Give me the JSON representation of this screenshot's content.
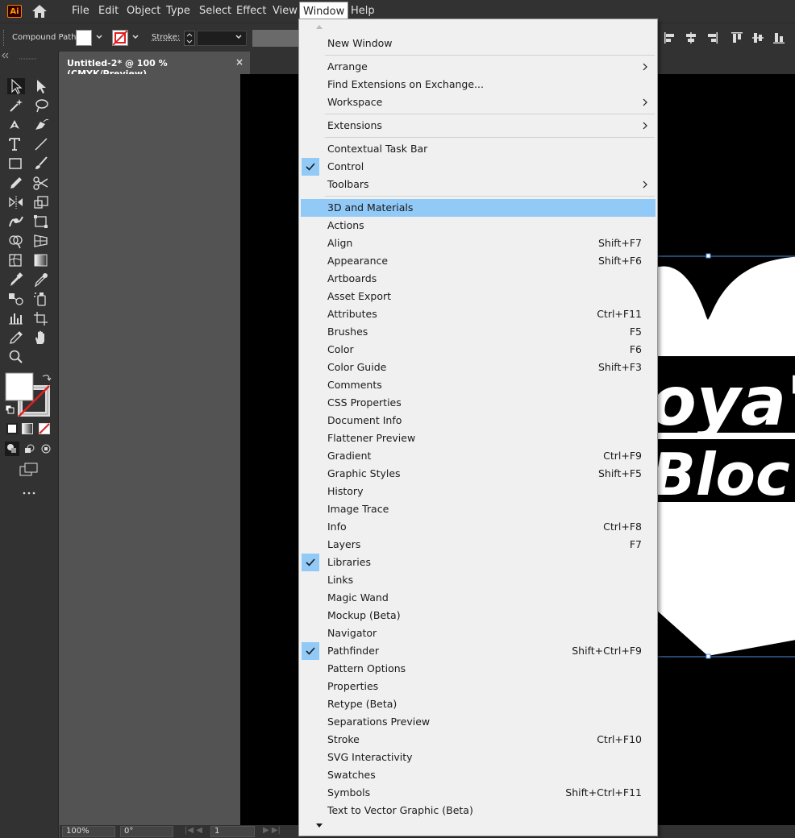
{
  "app": {
    "logo": "Ai",
    "menus": [
      "File",
      "Edit",
      "Object",
      "Type",
      "Select",
      "Effect",
      "View",
      "Window",
      "Help"
    ],
    "active_menu": "Window"
  },
  "control_bar": {
    "selection_type": "Compound Path",
    "stroke_label": "Stroke:"
  },
  "document": {
    "tab_title": "Untitled-2* @ 100 % (CMYK/Preview)",
    "close_glyph": "×"
  },
  "status_bar": {
    "zoom": "100%",
    "rotation": "0°",
    "artboard_number": "1"
  },
  "artwork": {
    "visible_text": [
      "oya'",
      "Bloc"
    ]
  },
  "window_menu": {
    "items": [
      {
        "label": "New Window",
        "shortcut": "",
        "submenu": false,
        "checked": false,
        "highlighted": false
      },
      {
        "separator": true
      },
      {
        "label": "Arrange",
        "shortcut": "",
        "submenu": true,
        "checked": false,
        "highlighted": false
      },
      {
        "label": "Find Extensions on Exchange...",
        "shortcut": "",
        "submenu": false,
        "checked": false,
        "highlighted": false
      },
      {
        "label": "Workspace",
        "shortcut": "",
        "submenu": true,
        "checked": false,
        "highlighted": false
      },
      {
        "separator": true
      },
      {
        "label": "Extensions",
        "shortcut": "",
        "submenu": true,
        "checked": false,
        "highlighted": false
      },
      {
        "separator": true
      },
      {
        "label": "Contextual Task Bar",
        "shortcut": "",
        "submenu": false,
        "checked": false,
        "highlighted": false
      },
      {
        "label": "Control",
        "shortcut": "",
        "submenu": false,
        "checked": true,
        "highlighted": false
      },
      {
        "label": "Toolbars",
        "shortcut": "",
        "submenu": true,
        "checked": false,
        "highlighted": false
      },
      {
        "separator": true
      },
      {
        "label": "3D and Materials",
        "shortcut": "",
        "submenu": false,
        "checked": false,
        "highlighted": true
      },
      {
        "label": "Actions",
        "shortcut": "",
        "submenu": false,
        "checked": false,
        "highlighted": false
      },
      {
        "label": "Align",
        "shortcut": "Shift+F7",
        "submenu": false,
        "checked": false,
        "highlighted": false
      },
      {
        "label": "Appearance",
        "shortcut": "Shift+F6",
        "submenu": false,
        "checked": false,
        "highlighted": false
      },
      {
        "label": "Artboards",
        "shortcut": "",
        "submenu": false,
        "checked": false,
        "highlighted": false
      },
      {
        "label": "Asset Export",
        "shortcut": "",
        "submenu": false,
        "checked": false,
        "highlighted": false
      },
      {
        "label": "Attributes",
        "shortcut": "Ctrl+F11",
        "submenu": false,
        "checked": false,
        "highlighted": false
      },
      {
        "label": "Brushes",
        "shortcut": "F5",
        "submenu": false,
        "checked": false,
        "highlighted": false
      },
      {
        "label": "Color",
        "shortcut": "F6",
        "submenu": false,
        "checked": false,
        "highlighted": false
      },
      {
        "label": "Color Guide",
        "shortcut": "Shift+F3",
        "submenu": false,
        "checked": false,
        "highlighted": false
      },
      {
        "label": "Comments",
        "shortcut": "",
        "submenu": false,
        "checked": false,
        "highlighted": false
      },
      {
        "label": "CSS Properties",
        "shortcut": "",
        "submenu": false,
        "checked": false,
        "highlighted": false
      },
      {
        "label": "Document Info",
        "shortcut": "",
        "submenu": false,
        "checked": false,
        "highlighted": false
      },
      {
        "label": "Flattener Preview",
        "shortcut": "",
        "submenu": false,
        "checked": false,
        "highlighted": false
      },
      {
        "label": "Gradient",
        "shortcut": "Ctrl+F9",
        "submenu": false,
        "checked": false,
        "highlighted": false
      },
      {
        "label": "Graphic Styles",
        "shortcut": "Shift+F5",
        "submenu": false,
        "checked": false,
        "highlighted": false
      },
      {
        "label": "History",
        "shortcut": "",
        "submenu": false,
        "checked": false,
        "highlighted": false
      },
      {
        "label": "Image Trace",
        "shortcut": "",
        "submenu": false,
        "checked": false,
        "highlighted": false
      },
      {
        "label": "Info",
        "shortcut": "Ctrl+F8",
        "submenu": false,
        "checked": false,
        "highlighted": false
      },
      {
        "label": "Layers",
        "shortcut": "F7",
        "submenu": false,
        "checked": false,
        "highlighted": false
      },
      {
        "label": "Libraries",
        "shortcut": "",
        "submenu": false,
        "checked": true,
        "highlighted": false
      },
      {
        "label": "Links",
        "shortcut": "",
        "submenu": false,
        "checked": false,
        "highlighted": false
      },
      {
        "label": "Magic Wand",
        "shortcut": "",
        "submenu": false,
        "checked": false,
        "highlighted": false
      },
      {
        "label": "Mockup (Beta)",
        "shortcut": "",
        "submenu": false,
        "checked": false,
        "highlighted": false
      },
      {
        "label": "Navigator",
        "shortcut": "",
        "submenu": false,
        "checked": false,
        "highlighted": false
      },
      {
        "label": "Pathfinder",
        "shortcut": "Shift+Ctrl+F9",
        "submenu": false,
        "checked": true,
        "highlighted": false
      },
      {
        "label": "Pattern Options",
        "shortcut": "",
        "submenu": false,
        "checked": false,
        "highlighted": false
      },
      {
        "label": "Properties",
        "shortcut": "",
        "submenu": false,
        "checked": false,
        "highlighted": false
      },
      {
        "label": "Retype (Beta)",
        "shortcut": "",
        "submenu": false,
        "checked": false,
        "highlighted": false
      },
      {
        "label": "Separations Preview",
        "shortcut": "",
        "submenu": false,
        "checked": false,
        "highlighted": false
      },
      {
        "label": "Stroke",
        "shortcut": "Ctrl+F10",
        "submenu": false,
        "checked": false,
        "highlighted": false
      },
      {
        "label": "SVG Interactivity",
        "shortcut": "",
        "submenu": false,
        "checked": false,
        "highlighted": false
      },
      {
        "label": "Swatches",
        "shortcut": "",
        "submenu": false,
        "checked": false,
        "highlighted": false
      },
      {
        "label": "Symbols",
        "shortcut": "Shift+Ctrl+F11",
        "submenu": false,
        "checked": false,
        "highlighted": false
      },
      {
        "label": "Text to Vector Graphic (Beta)",
        "shortcut": "",
        "submenu": false,
        "checked": false,
        "highlighted": false
      }
    ]
  },
  "colors": {
    "ui_dark": "#323232",
    "ui_mid": "#535353",
    "menu_bg": "#f0f0f0",
    "highlight": "#91c9f7",
    "logo_orange": "#ff9a00",
    "selection_blue": "#4a8fe0"
  }
}
